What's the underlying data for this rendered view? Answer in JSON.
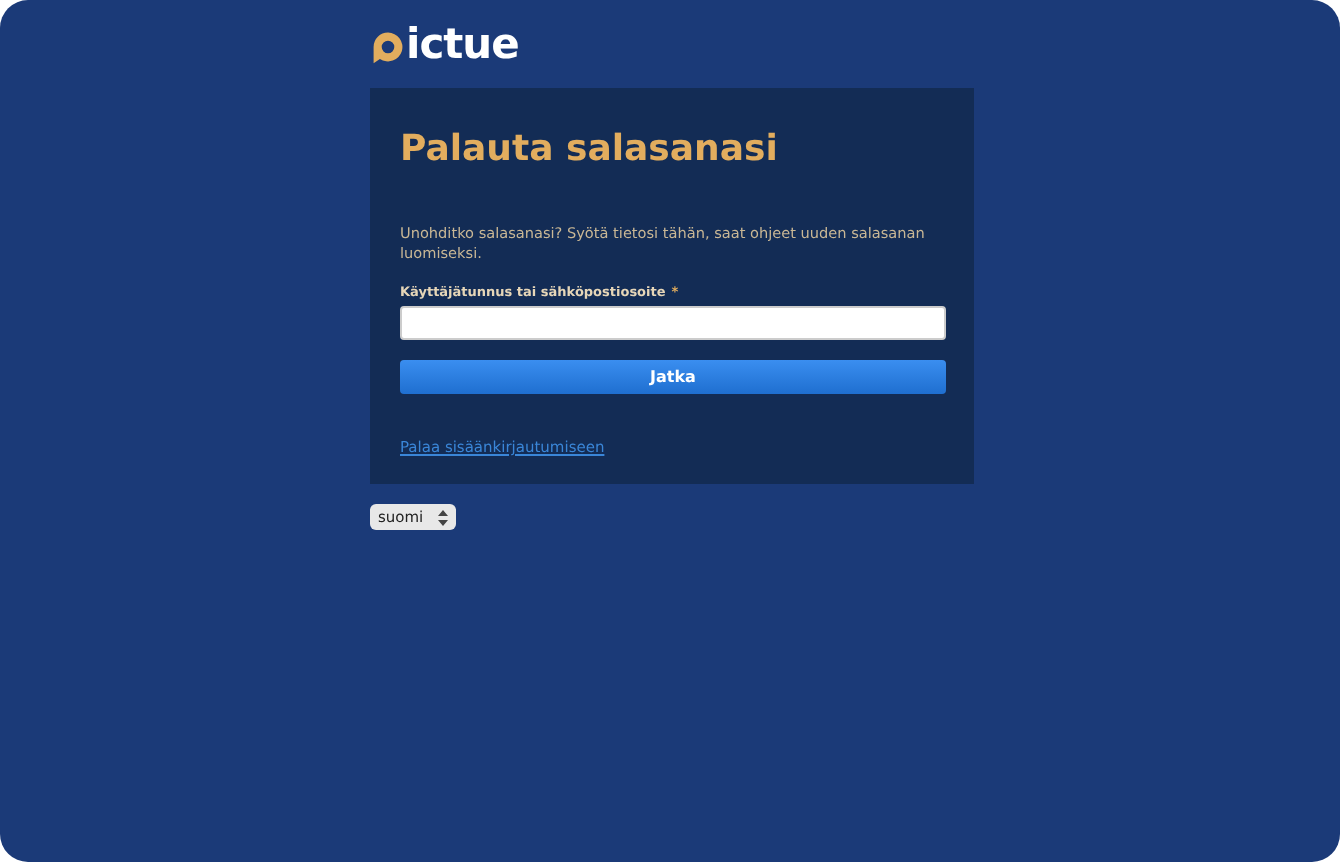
{
  "logo": {
    "text": "ictue"
  },
  "card": {
    "title": "Palauta salasanasi",
    "description": "Unohditko salasanasi? Syötä tietosi tähän, saat ohjeet uuden salasanan luomiseksi.",
    "field": {
      "label": "Käyttäjätunnus tai sähköpostiosoite",
      "required_mark": "*"
    },
    "button": "Jatka",
    "link": "Palaa sisäänkirjautumiseen"
  },
  "language_select": {
    "value": "suomi"
  }
}
